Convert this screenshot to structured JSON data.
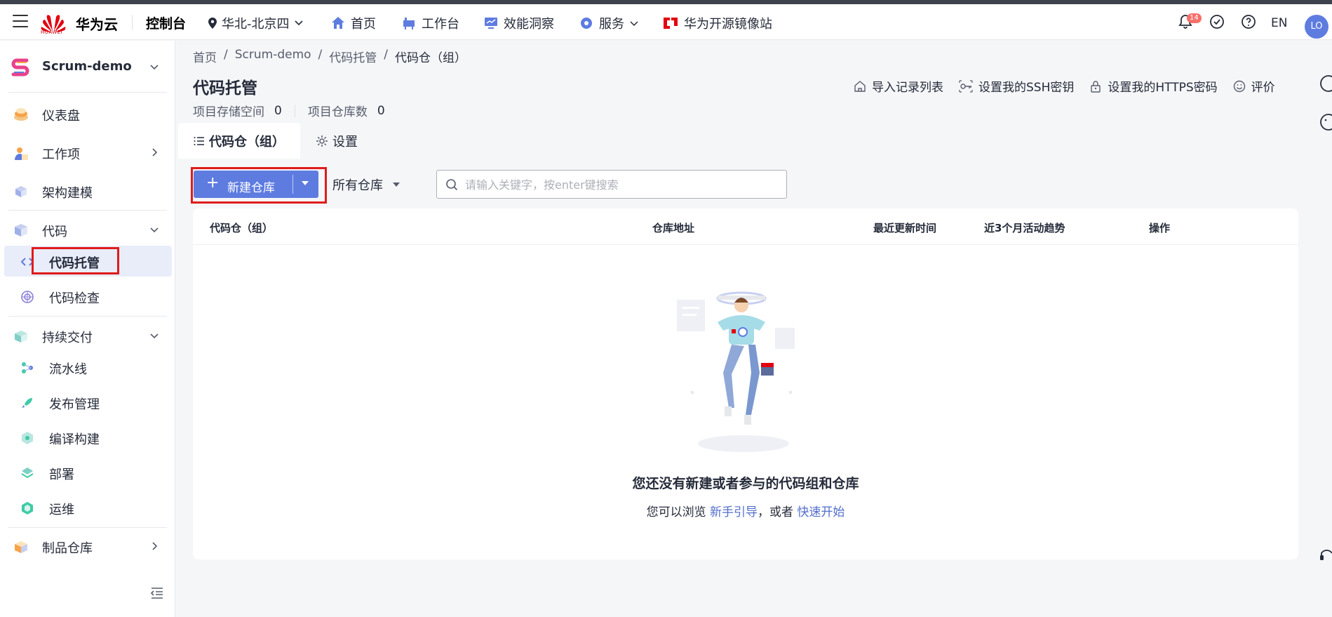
{
  "topbar": {
    "brand": "华为云",
    "logo_text": "HUAWEI",
    "console": "控制台",
    "region": "华北-北京四",
    "nav": [
      "首页",
      "工作台",
      "效能洞察",
      "服务",
      "华为开源镜像站"
    ],
    "notification_count": "14",
    "language": "EN",
    "avatar": "LO"
  },
  "sidebar": {
    "project": "Scrum-demo",
    "items": {
      "dashboard": "仪表盘",
      "workitems": "工作项",
      "architecture": "架构建模",
      "code": "代码",
      "code_hosting": "代码托管",
      "code_check": "代码检查",
      "cd": "持续交付",
      "pipeline": "流水线",
      "release": "发布管理",
      "build": "编译构建",
      "deploy": "部署",
      "ops": "运维",
      "artifacts": "制品仓库"
    }
  },
  "breadcrumb": [
    "首页",
    "/",
    "Scrum-demo",
    "/",
    "代码托管",
    "/",
    "代码仓（组）"
  ],
  "page": {
    "title": "代码托管",
    "storage_label": "项目存储空间",
    "storage_value": "0",
    "repo_count_label": "项目仓库数",
    "repo_count_value": "0",
    "actions": [
      "导入记录列表",
      "设置我的SSH密钥",
      "设置我的HTTPS密码",
      "评价"
    ],
    "tabs": [
      "代码仓（组）",
      "设置"
    ]
  },
  "toolbar": {
    "new_repo": "新建仓库",
    "filter": "所有仓库",
    "search_placeholder": "请输入关键字，按enter键搜索"
  },
  "table": {
    "columns": [
      "代码仓（组）",
      "仓库地址",
      "最近更新时间",
      "近3个月活动趋势",
      "操作"
    ]
  },
  "empty": {
    "title": "您还没有新建或者参与的代码组和仓库",
    "prefix": "您可以浏览",
    "link1": "新手引导",
    "middle": "，或者",
    "link2": "快速开始"
  },
  "colors": {
    "primary": "#5e7ce0",
    "highlight_box": "#e01b1b",
    "badge": "#f66f6a"
  }
}
